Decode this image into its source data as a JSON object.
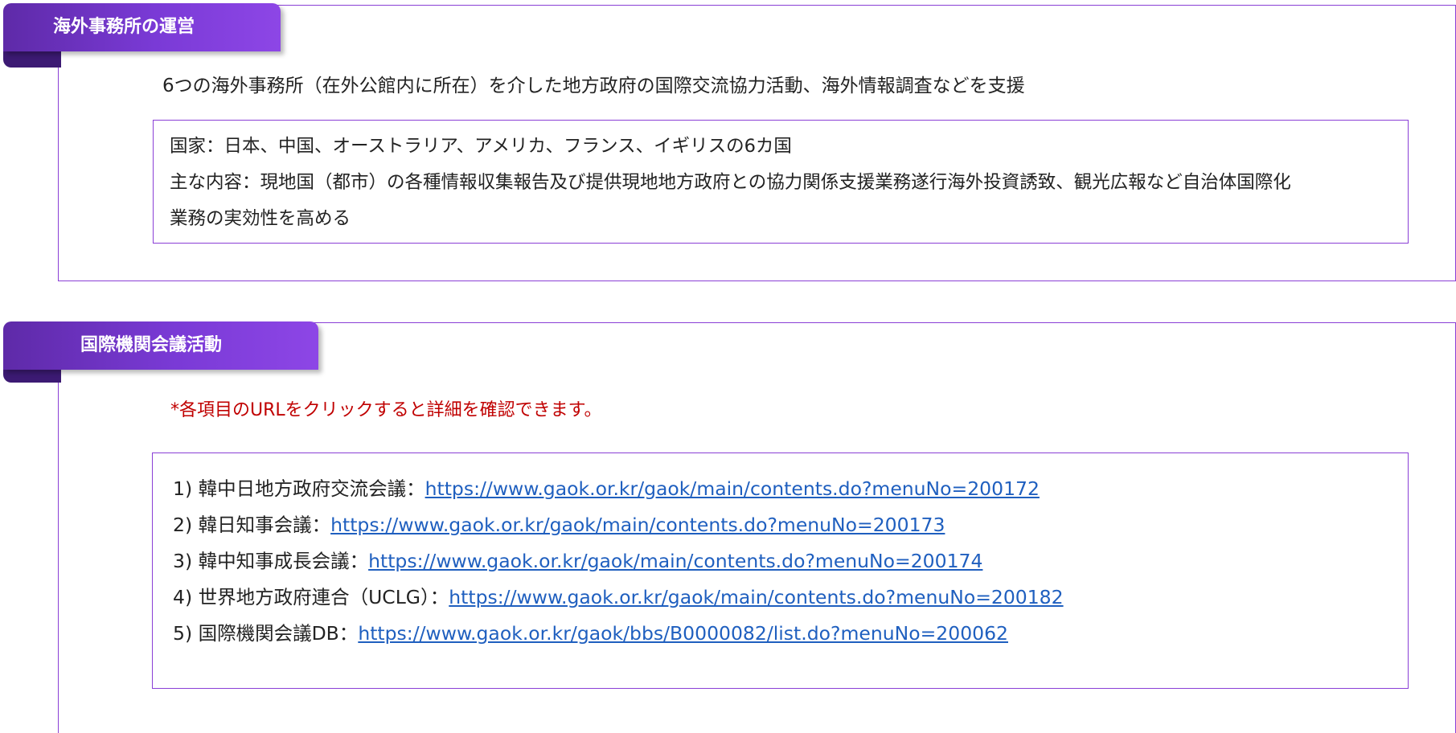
{
  "section1": {
    "title": "海外事務所の運営",
    "lead": "6つの海外事務所（在外公館内に所在）を介した地方政府の国際交流協力活動、海外情報調査などを支援",
    "details": {
      "countries": "国家：日本、中国、オーストラリア、アメリカ、フランス、イギリスの6カ国",
      "content_line1": "主な内容：現地国（都市）の各種情報収集報告及び提供現地地方政府との協力関係支援業務遂行海外投資誘致、観光広報など自治体国際化",
      "content_line2": "業務の実効性を高める"
    }
  },
  "section2": {
    "title": "国際機関会議活動",
    "note": "*各項目のURLをクリックすると詳細を確認できます。",
    "items": [
      {
        "prefix": "1)  韓中日地方政府交流会議：",
        "url": "https://www.gaok.or.kr/gaok/main/contents.do?menuNo=200172"
      },
      {
        "prefix": "2)  韓日知事会議：",
        "url": "https://www.gaok.or.kr/gaok/main/contents.do?menuNo=200173"
      },
      {
        "prefix": "3)  韓中知事成長会議：",
        "url": "https://www.gaok.or.kr/gaok/main/contents.do?menuNo=200174"
      },
      {
        "prefix": "4)  世界地方政府連合（UCLG）：",
        "url": "https://www.gaok.or.kr/gaok/main/contents.do?menuNo=200182"
      },
      {
        "prefix": "5)  国際機関会議DB：",
        "url": "https://www.gaok.or.kr/gaok/bbs/B0000082/list.do?menuNo=200062"
      }
    ]
  },
  "colors": {
    "accent_purple": "#8a3fd6",
    "tab_dark": "#3c1a73",
    "note_red": "#c00000",
    "link_blue": "#1f5fbf"
  }
}
